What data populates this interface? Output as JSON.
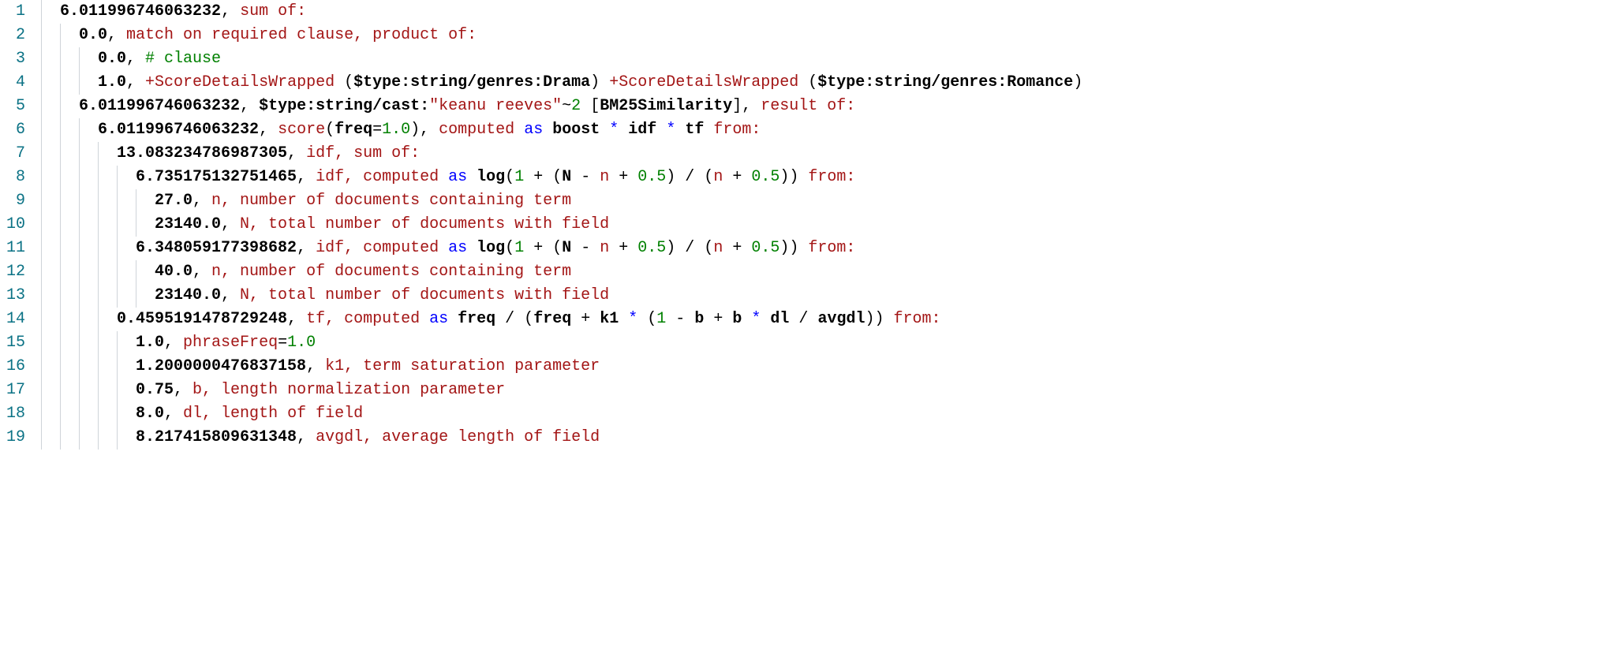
{
  "lines": [
    {
      "n": "1",
      "indent": 1,
      "tokens": [
        {
          "cls": "tok-num",
          "t": "6.011996746063232"
        },
        {
          "cls": "tok-op",
          "t": ", "
        },
        {
          "cls": "tok-redkw",
          "t": "sum of:"
        }
      ]
    },
    {
      "n": "2",
      "indent": 2,
      "tokens": [
        {
          "cls": "tok-num",
          "t": "0.0"
        },
        {
          "cls": "tok-op",
          "t": ", "
        },
        {
          "cls": "tok-redkw",
          "t": "match on required clause, product of:"
        }
      ]
    },
    {
      "n": "3",
      "indent": 3,
      "tokens": [
        {
          "cls": "tok-num",
          "t": "0.0"
        },
        {
          "cls": "tok-op",
          "t": ", "
        },
        {
          "cls": "tok-comment",
          "t": "# clause"
        }
      ]
    },
    {
      "n": "4",
      "indent": 3,
      "tokens": [
        {
          "cls": "tok-num",
          "t": "1.0"
        },
        {
          "cls": "tok-op",
          "t": ", "
        },
        {
          "cls": "tok-redkw",
          "t": "+ScoreDetailsWrapped"
        },
        {
          "cls": "tok-op",
          "t": " ("
        },
        {
          "cls": "tok-key",
          "t": "$type:string/genres:Drama"
        },
        {
          "cls": "tok-op",
          "t": ") "
        },
        {
          "cls": "tok-redkw",
          "t": "+ScoreDetailsWrapped"
        },
        {
          "cls": "tok-op",
          "t": " ("
        },
        {
          "cls": "tok-key",
          "t": "$type:string/genres:Romance"
        },
        {
          "cls": "tok-op",
          "t": ")"
        }
      ]
    },
    {
      "n": "5",
      "indent": 2,
      "tokens": [
        {
          "cls": "tok-num",
          "t": "6.011996746063232"
        },
        {
          "cls": "tok-op",
          "t": ", "
        },
        {
          "cls": "tok-key",
          "t": "$type:string/cast:"
        },
        {
          "cls": "tok-redkw",
          "t": "\"keanu reeves\""
        },
        {
          "cls": "tok-op",
          "t": "~"
        },
        {
          "cls": "tok-green",
          "t": "2"
        },
        {
          "cls": "tok-op",
          "t": " ["
        },
        {
          "cls": "tok-key",
          "t": "BM25Similarity"
        },
        {
          "cls": "tok-op",
          "t": "], "
        },
        {
          "cls": "tok-redkw",
          "t": "result of:"
        }
      ]
    },
    {
      "n": "6",
      "indent": 3,
      "tokens": [
        {
          "cls": "tok-num",
          "t": "6.011996746063232"
        },
        {
          "cls": "tok-op",
          "t": ", "
        },
        {
          "cls": "tok-redkw",
          "t": "score"
        },
        {
          "cls": "tok-op",
          "t": "("
        },
        {
          "cls": "tok-key",
          "t": "freq"
        },
        {
          "cls": "tok-op",
          "t": "="
        },
        {
          "cls": "tok-green",
          "t": "1.0"
        },
        {
          "cls": "tok-op",
          "t": "), "
        },
        {
          "cls": "tok-redkw",
          "t": "computed"
        },
        {
          "cls": "tok-op",
          "t": " "
        },
        {
          "cls": "tok-blue",
          "t": "as"
        },
        {
          "cls": "tok-op",
          "t": " "
        },
        {
          "cls": "tok-key",
          "t": "boost"
        },
        {
          "cls": "tok-op",
          "t": " "
        },
        {
          "cls": "tok-blue",
          "t": "*"
        },
        {
          "cls": "tok-op",
          "t": " "
        },
        {
          "cls": "tok-key",
          "t": "idf"
        },
        {
          "cls": "tok-op",
          "t": " "
        },
        {
          "cls": "tok-blue",
          "t": "*"
        },
        {
          "cls": "tok-op",
          "t": " "
        },
        {
          "cls": "tok-key",
          "t": "tf"
        },
        {
          "cls": "tok-op",
          "t": " "
        },
        {
          "cls": "tok-redkw",
          "t": "from:"
        }
      ]
    },
    {
      "n": "7",
      "indent": 4,
      "tokens": [
        {
          "cls": "tok-num",
          "t": "13.083234786987305"
        },
        {
          "cls": "tok-op",
          "t": ", "
        },
        {
          "cls": "tok-redkw",
          "t": "idf, sum of:"
        }
      ]
    },
    {
      "n": "8",
      "indent": 5,
      "tokens": [
        {
          "cls": "tok-num",
          "t": "6.735175132751465"
        },
        {
          "cls": "tok-op",
          "t": ", "
        },
        {
          "cls": "tok-redkw",
          "t": "idf, computed"
        },
        {
          "cls": "tok-op",
          "t": " "
        },
        {
          "cls": "tok-blue",
          "t": "as"
        },
        {
          "cls": "tok-op",
          "t": " "
        },
        {
          "cls": "tok-key",
          "t": "log"
        },
        {
          "cls": "tok-op",
          "t": "("
        },
        {
          "cls": "tok-green",
          "t": "1"
        },
        {
          "cls": "tok-op",
          "t": " + ("
        },
        {
          "cls": "tok-key",
          "t": "N"
        },
        {
          "cls": "tok-op",
          "t": " - "
        },
        {
          "cls": "tok-redkw",
          "t": "n"
        },
        {
          "cls": "tok-op",
          "t": " + "
        },
        {
          "cls": "tok-green",
          "t": "0.5"
        },
        {
          "cls": "tok-op",
          "t": ") / ("
        },
        {
          "cls": "tok-redkw",
          "t": "n"
        },
        {
          "cls": "tok-op",
          "t": " + "
        },
        {
          "cls": "tok-green",
          "t": "0.5"
        },
        {
          "cls": "tok-op",
          "t": ")) "
        },
        {
          "cls": "tok-redkw",
          "t": "from:"
        }
      ]
    },
    {
      "n": "9",
      "indent": 6,
      "tokens": [
        {
          "cls": "tok-num",
          "t": "27.0"
        },
        {
          "cls": "tok-op",
          "t": ", "
        },
        {
          "cls": "tok-redkw",
          "t": "n, number of documents containing term"
        }
      ]
    },
    {
      "n": "10",
      "indent": 6,
      "tokens": [
        {
          "cls": "tok-num",
          "t": "23140.0"
        },
        {
          "cls": "tok-op",
          "t": ", "
        },
        {
          "cls": "tok-redkw",
          "t": "N, total number of documents with field"
        }
      ]
    },
    {
      "n": "11",
      "indent": 5,
      "tokens": [
        {
          "cls": "tok-num",
          "t": "6.348059177398682"
        },
        {
          "cls": "tok-op",
          "t": ", "
        },
        {
          "cls": "tok-redkw",
          "t": "idf, computed"
        },
        {
          "cls": "tok-op",
          "t": " "
        },
        {
          "cls": "tok-blue",
          "t": "as"
        },
        {
          "cls": "tok-op",
          "t": " "
        },
        {
          "cls": "tok-key",
          "t": "log"
        },
        {
          "cls": "tok-op",
          "t": "("
        },
        {
          "cls": "tok-green",
          "t": "1"
        },
        {
          "cls": "tok-op",
          "t": " + ("
        },
        {
          "cls": "tok-key",
          "t": "N"
        },
        {
          "cls": "tok-op",
          "t": " - "
        },
        {
          "cls": "tok-redkw",
          "t": "n"
        },
        {
          "cls": "tok-op",
          "t": " + "
        },
        {
          "cls": "tok-green",
          "t": "0.5"
        },
        {
          "cls": "tok-op",
          "t": ") / ("
        },
        {
          "cls": "tok-redkw",
          "t": "n"
        },
        {
          "cls": "tok-op",
          "t": " + "
        },
        {
          "cls": "tok-green",
          "t": "0.5"
        },
        {
          "cls": "tok-op",
          "t": ")) "
        },
        {
          "cls": "tok-redkw",
          "t": "from:"
        }
      ]
    },
    {
      "n": "12",
      "indent": 6,
      "tokens": [
        {
          "cls": "tok-num",
          "t": "40.0"
        },
        {
          "cls": "tok-op",
          "t": ", "
        },
        {
          "cls": "tok-redkw",
          "t": "n, number of documents containing term"
        }
      ]
    },
    {
      "n": "13",
      "indent": 6,
      "tokens": [
        {
          "cls": "tok-num",
          "t": "23140.0"
        },
        {
          "cls": "tok-op",
          "t": ", "
        },
        {
          "cls": "tok-redkw",
          "t": "N, total number of documents with field"
        }
      ]
    },
    {
      "n": "14",
      "indent": 4,
      "tokens": [
        {
          "cls": "tok-num",
          "t": "0.4595191478729248"
        },
        {
          "cls": "tok-op",
          "t": ", "
        },
        {
          "cls": "tok-redkw",
          "t": "tf, computed"
        },
        {
          "cls": "tok-op",
          "t": " "
        },
        {
          "cls": "tok-blue",
          "t": "as"
        },
        {
          "cls": "tok-op",
          "t": " "
        },
        {
          "cls": "tok-key",
          "t": "freq"
        },
        {
          "cls": "tok-op",
          "t": " / ("
        },
        {
          "cls": "tok-key",
          "t": "freq"
        },
        {
          "cls": "tok-op",
          "t": " + "
        },
        {
          "cls": "tok-key",
          "t": "k1"
        },
        {
          "cls": "tok-op",
          "t": " "
        },
        {
          "cls": "tok-blue",
          "t": "*"
        },
        {
          "cls": "tok-op",
          "t": " ("
        },
        {
          "cls": "tok-green",
          "t": "1"
        },
        {
          "cls": "tok-op",
          "t": " - "
        },
        {
          "cls": "tok-key",
          "t": "b"
        },
        {
          "cls": "tok-op",
          "t": " + "
        },
        {
          "cls": "tok-key",
          "t": "b"
        },
        {
          "cls": "tok-op",
          "t": " "
        },
        {
          "cls": "tok-blue",
          "t": "*"
        },
        {
          "cls": "tok-op",
          "t": " "
        },
        {
          "cls": "tok-key",
          "t": "dl"
        },
        {
          "cls": "tok-op",
          "t": " / "
        },
        {
          "cls": "tok-key",
          "t": "avgdl"
        },
        {
          "cls": "tok-op",
          "t": ")) "
        },
        {
          "cls": "tok-redkw",
          "t": "from:"
        }
      ]
    },
    {
      "n": "15",
      "indent": 5,
      "tokens": [
        {
          "cls": "tok-num",
          "t": "1.0"
        },
        {
          "cls": "tok-op",
          "t": ", "
        },
        {
          "cls": "tok-redkw",
          "t": "phraseFreq"
        },
        {
          "cls": "tok-op",
          "t": "="
        },
        {
          "cls": "tok-green",
          "t": "1.0"
        }
      ]
    },
    {
      "n": "16",
      "indent": 5,
      "tokens": [
        {
          "cls": "tok-num",
          "t": "1.2000000476837158"
        },
        {
          "cls": "tok-op",
          "t": ", "
        },
        {
          "cls": "tok-redkw",
          "t": "k1, term saturation parameter"
        }
      ]
    },
    {
      "n": "17",
      "indent": 5,
      "tokens": [
        {
          "cls": "tok-num",
          "t": "0.75"
        },
        {
          "cls": "tok-op",
          "t": ", "
        },
        {
          "cls": "tok-redkw",
          "t": "b, length normalization parameter"
        }
      ]
    },
    {
      "n": "18",
      "indent": 5,
      "tokens": [
        {
          "cls": "tok-num",
          "t": "8.0"
        },
        {
          "cls": "tok-op",
          "t": ", "
        },
        {
          "cls": "tok-redkw",
          "t": "dl, length of field"
        }
      ]
    },
    {
      "n": "19",
      "indent": 5,
      "tokens": [
        {
          "cls": "tok-num",
          "t": "8.217415809631348"
        },
        {
          "cls": "tok-op",
          "t": ", "
        },
        {
          "cls": "tok-redkw",
          "t": "avgdl, average length of field"
        }
      ]
    }
  ]
}
